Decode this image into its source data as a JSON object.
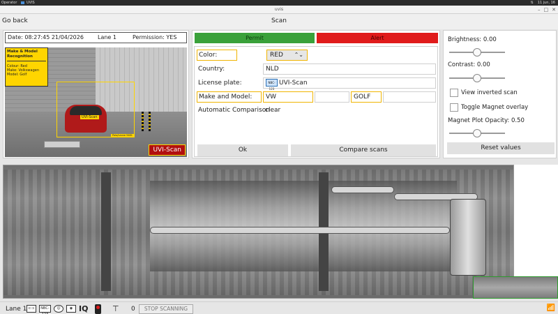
{
  "os_bar": {
    "user": "Operator",
    "app_name": "UVIS",
    "date": "11 jun, 16"
  },
  "window": {
    "title": "uvis"
  },
  "nav": {
    "go_back": "Go back",
    "page_title": "Scan"
  },
  "info": {
    "datetime": "Date: 08:27:45 21/04/2026",
    "lane": "Lane 1",
    "permission": "Permission: YES"
  },
  "mmr": {
    "title": "Make & Model Recognition",
    "colour": "Colour: Red",
    "make": "Make: Volkswagen",
    "model": "Model: Golf",
    "detection_label": "UVI-Scan",
    "confidence_label": "Polo/Leone 9481"
  },
  "photo_watermark": "UVI-Scan",
  "actions": {
    "permit": "Permit",
    "alert": "Alert",
    "permit_color": "#3aa13a",
    "alert_color": "#e01b1b"
  },
  "form": {
    "color_label": "Color:",
    "color_value": "RED",
    "country_label": "Country:",
    "country_value": "NLD",
    "plate_label": "License plate:",
    "plate_icon_text": "NBC-123",
    "plate_value": "UVI-Scan",
    "make_model_label": "Make and Model:",
    "make_value": "VW",
    "model_value": "GOLF",
    "auto_compare_label": "Automatic Comparison",
    "auto_compare_value": "clear",
    "ok_button": "Ok",
    "compare_button": "Compare scans"
  },
  "settings": {
    "brightness_label": "Brightness: 0.00",
    "brightness": 0.0,
    "contrast_label": "Contrast: 0.00",
    "contrast": 0.0,
    "inverted_label": "View inverted scan",
    "inverted_checked": false,
    "magnet_label": "Toggle Magnet overlay",
    "magnet_checked": false,
    "opacity_label": "Magnet Plot Opacity: 0.50",
    "opacity": 0.5,
    "reset_button": "Reset values"
  },
  "status": {
    "lane": "Lane 1",
    "plate_icon_text": "NBC-123",
    "iq": "IQ",
    "count": "0",
    "stop_button": "STOP SCANNING"
  }
}
